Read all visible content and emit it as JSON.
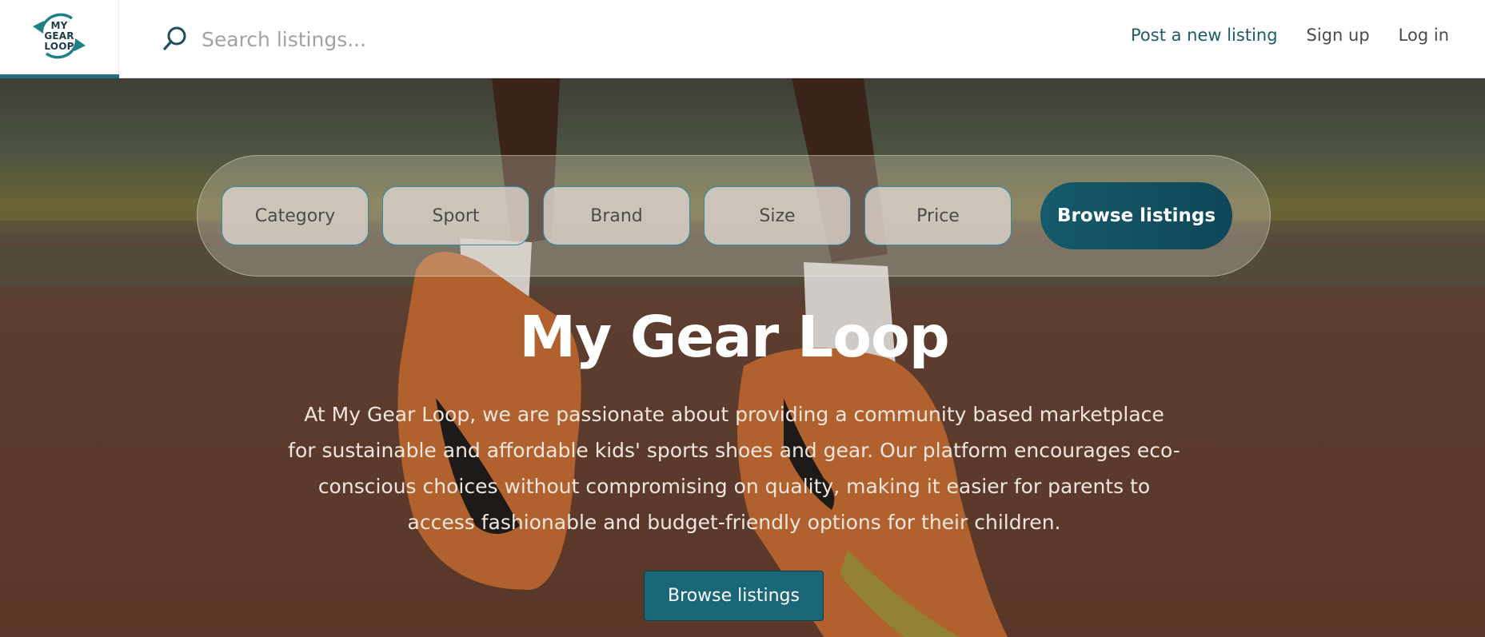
{
  "brand": {
    "logo_lines": [
      "MY",
      "GEAR",
      "LOOP"
    ],
    "color": "#1f6f7f"
  },
  "search": {
    "placeholder": "Search listings...",
    "value": ""
  },
  "nav": {
    "post_listing": "Post a new listing",
    "sign_up": "Sign up",
    "log_in": "Log in"
  },
  "filters": {
    "chips": [
      {
        "label": "Category"
      },
      {
        "label": "Sport"
      },
      {
        "label": "Brand"
      },
      {
        "label": "Size"
      },
      {
        "label": "Price"
      }
    ],
    "browse_label": "Browse listings"
  },
  "hero": {
    "title": "My Gear Loop",
    "description": "At My Gear Loop, we are passionate about providing a community based marketplace for sustainable and affordable kids' sports shoes and gear. Our platform encourages eco-conscious choices without compromising on quality, making it easier for parents to access fashionable and budget-friendly options for their children.",
    "button_label": "Browse listings"
  },
  "icons": {
    "search": "search-icon",
    "logo": "recycle-arrows-logo"
  },
  "colors": {
    "accent": "#1a6779",
    "accent_dark": "#0e4758",
    "nav_primary": "#1f5a6a"
  }
}
